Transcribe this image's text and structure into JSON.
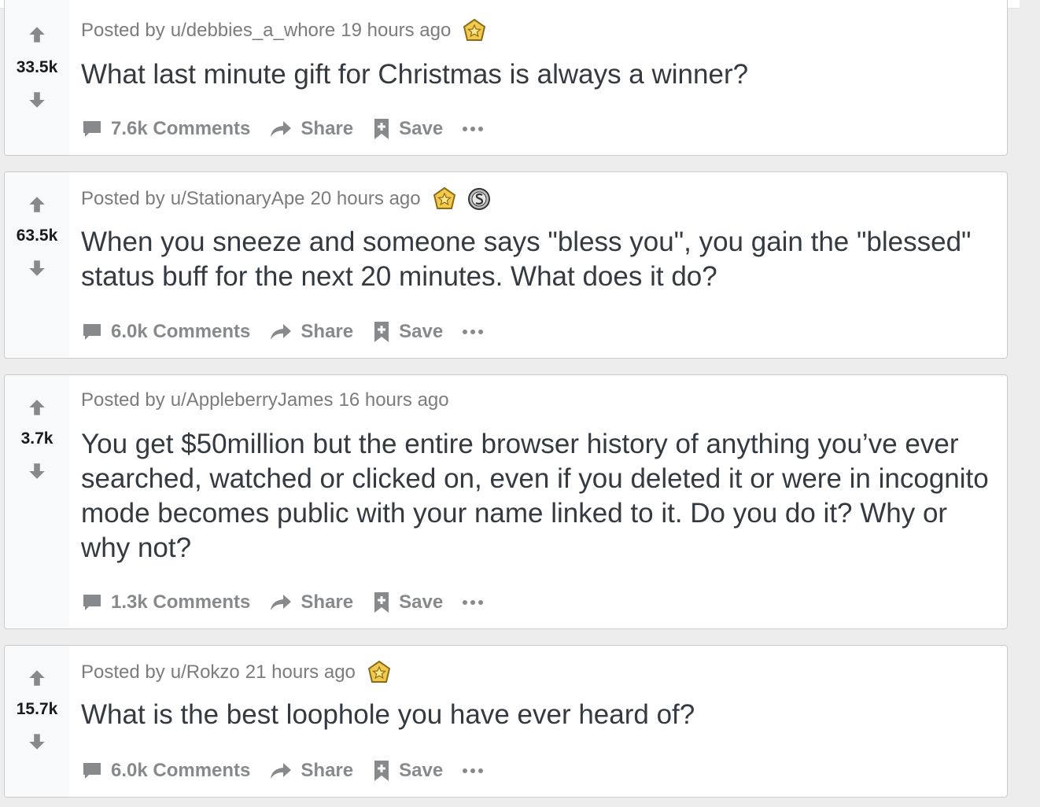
{
  "colors": {
    "arrow": "#878a8c",
    "award_gold": "#f2c94c",
    "award_silver": "#c0c0c0"
  },
  "labels": {
    "share": "Share",
    "save": "Save",
    "posted_by": "Posted by"
  },
  "posts": [
    {
      "score": "33.5k",
      "author": "u/debbies_a_whore",
      "time": "19 hours ago",
      "title": "What last minute gift for Christmas is always a winner?",
      "comments": "7.6k Comments",
      "awards": [
        "gold-award"
      ]
    },
    {
      "score": "63.5k",
      "author": "u/StationaryApe",
      "time": "20 hours ago",
      "title": "When you sneeze and someone says \"bless you\", you gain the \"blessed\" status buff for the next 20 minutes. What does it do?",
      "comments": "6.0k Comments",
      "awards": [
        "gold-award",
        "silver-award"
      ]
    },
    {
      "score": "3.7k",
      "author": "u/AppleberryJames",
      "time": "16 hours ago",
      "title": "You get $50million but the entire browser history of anything you’ve ever searched, watched or clicked on, even if you deleted it or were in incognito mode becomes public with your name linked to it. Do you do it? Why or why not?",
      "comments": "1.3k Comments",
      "awards": []
    },
    {
      "score": "15.7k",
      "author": "u/Rokzo",
      "time": "21 hours ago",
      "title": "What is the best loophole you have ever heard of?",
      "comments": "6.0k Comments",
      "awards": [
        "gold-award"
      ]
    }
  ]
}
